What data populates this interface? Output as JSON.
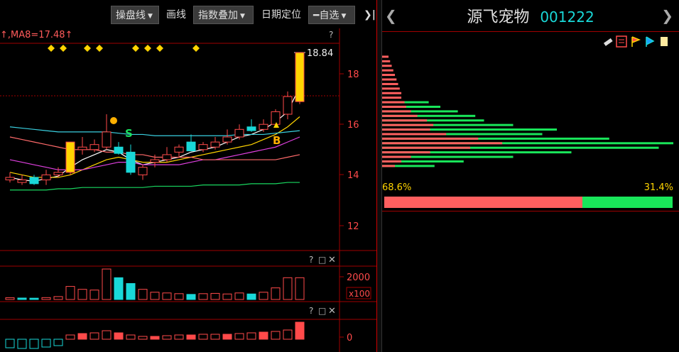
{
  "toolbar": {
    "cost_dist_label": "操盘线",
    "draw_label": "画线",
    "index_overlay_label": "指数叠加",
    "date_locate_label": "日期定位",
    "watchlist_label": "自选",
    "collapse_glyph": "❯|"
  },
  "main_panel": {
    "ma_legend": "↑,MA8=17.48↑",
    "help_mark": "?",
    "price_high_label": "18.84",
    "y_ticks": [
      "18",
      "16",
      "14",
      "12"
    ],
    "signal_sell": "S",
    "signal_buy": "B"
  },
  "volume_panel": {
    "y_tick": "2000",
    "unit_label": "x100",
    "controls": [
      "?",
      "□",
      "✕"
    ]
  },
  "indicator_panel": {
    "y_tick": "0",
    "controls": [
      "?",
      "□",
      "✕"
    ]
  },
  "stock": {
    "name": "源飞宠物",
    "code": "001222"
  },
  "chip_panel": {
    "profit_ratio_label": "68.6%",
    "loss_ratio_label": "31.4%",
    "profit_ratio": 0.686,
    "colors": {
      "profit": "#ff5f5f",
      "loss": "#19e65a"
    }
  },
  "colors": {
    "up": "#ff4a4a",
    "down": "#19d8d8",
    "accent_yellow": "#ffd400",
    "grid_red": "#a00000"
  },
  "chart_data": {
    "type": "candlestick",
    "y_range": [
      11.0,
      19.3
    ],
    "candles": [
      {
        "o": 13.9,
        "h": 14.1,
        "l": 13.7,
        "c": 13.8,
        "color": "up"
      },
      {
        "o": 13.8,
        "h": 14.0,
        "l": 13.6,
        "c": 13.7,
        "color": "up"
      },
      {
        "o": 13.9,
        "h": 14.0,
        "l": 13.6,
        "c": 13.65,
        "color": "down"
      },
      {
        "o": 13.8,
        "h": 14.2,
        "l": 13.6,
        "c": 14.0,
        "color": "up"
      },
      {
        "o": 14.0,
        "h": 14.3,
        "l": 13.9,
        "c": 14.1,
        "color": "up"
      },
      {
        "o": 14.1,
        "h": 15.3,
        "l": 14.0,
        "c": 15.3,
        "color": "limit"
      },
      {
        "o": 15.0,
        "h": 15.5,
        "l": 14.8,
        "c": 15.1,
        "color": "up"
      },
      {
        "o": 15.0,
        "h": 15.4,
        "l": 14.9,
        "c": 15.2,
        "color": "up"
      },
      {
        "o": 15.1,
        "h": 16.4,
        "l": 15.0,
        "c": 15.7,
        "color": "up"
      },
      {
        "o": 15.1,
        "h": 15.3,
        "l": 14.8,
        "c": 14.85,
        "color": "down"
      },
      {
        "o": 14.9,
        "h": 15.2,
        "l": 14.0,
        "c": 14.1,
        "color": "down"
      },
      {
        "o": 14.0,
        "h": 14.4,
        "l": 13.8,
        "c": 14.3,
        "color": "up"
      },
      {
        "o": 14.5,
        "h": 14.8,
        "l": 14.3,
        "c": 14.6,
        "color": "up"
      },
      {
        "o": 14.6,
        "h": 15.1,
        "l": 14.5,
        "c": 14.8,
        "color": "up"
      },
      {
        "o": 14.9,
        "h": 15.2,
        "l": 14.7,
        "c": 15.1,
        "color": "up"
      },
      {
        "o": 15.3,
        "h": 15.6,
        "l": 15.0,
        "c": 14.95,
        "color": "down"
      },
      {
        "o": 15.0,
        "h": 15.3,
        "l": 14.9,
        "c": 15.2,
        "color": "up"
      },
      {
        "o": 15.1,
        "h": 15.5,
        "l": 15.0,
        "c": 15.3,
        "color": "up"
      },
      {
        "o": 15.3,
        "h": 15.8,
        "l": 15.2,
        "c": 15.5,
        "color": "up"
      },
      {
        "o": 15.5,
        "h": 16.0,
        "l": 15.4,
        "c": 15.8,
        "color": "up"
      },
      {
        "o": 15.9,
        "h": 16.2,
        "l": 15.7,
        "c": 15.75,
        "color": "down"
      },
      {
        "o": 15.8,
        "h": 16.2,
        "l": 15.7,
        "c": 16.0,
        "color": "up"
      },
      {
        "o": 16.0,
        "h": 16.6,
        "l": 15.9,
        "c": 16.5,
        "color": "up"
      },
      {
        "o": 16.4,
        "h": 17.3,
        "l": 16.2,
        "c": 17.1,
        "color": "up"
      },
      {
        "o": 16.9,
        "h": 18.84,
        "l": 16.8,
        "c": 18.84,
        "color": "limit"
      }
    ],
    "volume": [
      {
        "v": 120,
        "color": "up"
      },
      {
        "v": 100,
        "color": "down"
      },
      {
        "v": 90,
        "color": "down"
      },
      {
        "v": 130,
        "color": "up"
      },
      {
        "v": 200,
        "color": "up"
      },
      {
        "v": 900,
        "color": "up"
      },
      {
        "v": 700,
        "color": "up"
      },
      {
        "v": 650,
        "color": "up"
      },
      {
        "v": 2100,
        "color": "up"
      },
      {
        "v": 1500,
        "color": "down"
      },
      {
        "v": 1100,
        "color": "down"
      },
      {
        "v": 700,
        "color": "up"
      },
      {
        "v": 500,
        "color": "up"
      },
      {
        "v": 450,
        "color": "up"
      },
      {
        "v": 400,
        "color": "up"
      },
      {
        "v": 350,
        "color": "down"
      },
      {
        "v": 400,
        "color": "up"
      },
      {
        "v": 420,
        "color": "up"
      },
      {
        "v": 380,
        "color": "up"
      },
      {
        "v": 450,
        "color": "up"
      },
      {
        "v": 380,
        "color": "down"
      },
      {
        "v": 500,
        "color": "up"
      },
      {
        "v": 800,
        "color": "up"
      },
      {
        "v": 1500,
        "color": "up"
      },
      {
        "v": 1500,
        "color": "up"
      }
    ],
    "indicator": [
      {
        "v": -1.2,
        "color": "down"
      },
      {
        "v": -1.3,
        "color": "down"
      },
      {
        "v": -1.3,
        "color": "down"
      },
      {
        "v": -1.1,
        "color": "down"
      },
      {
        "v": -0.9,
        "color": "down"
      },
      {
        "v": 0.6,
        "color": "up"
      },
      {
        "v": 0.8,
        "color": "up"
      },
      {
        "v": 0.9,
        "color": "up"
      },
      {
        "v": 1.2,
        "color": "up"
      },
      {
        "v": 0.9,
        "color": "up"
      },
      {
        "v": 0.6,
        "color": "up"
      },
      {
        "v": 0.4,
        "color": "up"
      },
      {
        "v": 0.4,
        "color": "up"
      },
      {
        "v": 0.5,
        "color": "up"
      },
      {
        "v": 0.6,
        "color": "up"
      },
      {
        "v": 0.6,
        "color": "up"
      },
      {
        "v": 0.7,
        "color": "up"
      },
      {
        "v": 0.7,
        "color": "up"
      },
      {
        "v": 0.7,
        "color": "up"
      },
      {
        "v": 0.8,
        "color": "up"
      },
      {
        "v": 0.9,
        "color": "up"
      },
      {
        "v": 1.0,
        "color": "up"
      },
      {
        "v": 1.1,
        "color": "up"
      },
      {
        "v": 1.3,
        "color": "up"
      },
      {
        "v": 2.4,
        "color": "up"
      }
    ],
    "ma_lines": [
      {
        "color": "#ffffff",
        "values": [
          13.9,
          13.8,
          13.75,
          13.85,
          13.95,
          14.3,
          14.6,
          14.8,
          15.0,
          14.9,
          14.6,
          14.4,
          14.5,
          14.6,
          14.7,
          14.9,
          15.0,
          15.1,
          15.3,
          15.5,
          15.6,
          15.8,
          16.1,
          16.5,
          17.48
        ]
      },
      {
        "color": "#ffd400",
        "values": [
          14.1,
          14.0,
          13.9,
          13.9,
          13.9,
          14.0,
          14.2,
          14.4,
          14.6,
          14.7,
          14.6,
          14.5,
          14.5,
          14.5,
          14.6,
          14.7,
          14.8,
          14.9,
          15.0,
          15.1,
          15.2,
          15.4,
          15.6,
          15.9,
          16.3
        ]
      },
      {
        "color": "#e040e0",
        "values": [
          14.6,
          14.5,
          14.4,
          14.3,
          14.2,
          14.2,
          14.2,
          14.3,
          14.4,
          14.5,
          14.5,
          14.4,
          14.4,
          14.4,
          14.4,
          14.5,
          14.6,
          14.6,
          14.7,
          14.8,
          14.9,
          15.0,
          15.1,
          15.3,
          15.5
        ]
      },
      {
        "color": "#3ad0e0",
        "values": [
          15.9,
          15.85,
          15.8,
          15.75,
          15.7,
          15.7,
          15.7,
          15.7,
          15.7,
          15.65,
          15.6,
          15.6,
          15.55,
          15.55,
          15.55,
          15.55,
          15.55,
          15.55,
          15.55,
          15.6,
          15.6,
          15.6,
          15.65,
          15.7,
          15.75
        ]
      },
      {
        "color": "#ff6a6a",
        "values": [
          15.5,
          15.4,
          15.3,
          15.2,
          15.1,
          15.0,
          15.0,
          15.0,
          14.9,
          14.9,
          14.8,
          14.8,
          14.7,
          14.7,
          14.7,
          14.7,
          14.6,
          14.6,
          14.6,
          14.6,
          14.6,
          14.6,
          14.6,
          14.7,
          14.8
        ]
      },
      {
        "color": "#19d860",
        "values": [
          13.4,
          13.4,
          13.4,
          13.4,
          13.45,
          13.45,
          13.5,
          13.5,
          13.5,
          13.5,
          13.5,
          13.5,
          13.55,
          13.55,
          13.55,
          13.55,
          13.6,
          13.6,
          13.6,
          13.6,
          13.65,
          13.65,
          13.65,
          13.7,
          13.7
        ]
      }
    ],
    "chip_distribution": {
      "price_range": [
        13.7,
        19.0
      ],
      "profit_levels": [
        {
          "p": 14.0,
          "w": 0.08
        },
        {
          "p": 14.2,
          "w": 0.12
        },
        {
          "p": 14.4,
          "w": 0.18
        },
        {
          "p": 14.6,
          "w": 0.3
        },
        {
          "p": 14.8,
          "w": 0.55
        },
        {
          "p": 15.0,
          "w": 0.75
        },
        {
          "p": 15.2,
          "w": 0.6
        },
        {
          "p": 15.4,
          "w": 0.4
        },
        {
          "p": 15.6,
          "w": 0.3
        },
        {
          "p": 15.8,
          "w": 0.32
        },
        {
          "p": 16.0,
          "w": 0.28
        },
        {
          "p": 16.2,
          "w": 0.22
        },
        {
          "p": 16.4,
          "w": 0.18
        },
        {
          "p": 16.6,
          "w": 0.15
        },
        {
          "p": 16.8,
          "w": 0.14
        },
        {
          "p": 17.0,
          "w": 0.12
        },
        {
          "p": 17.2,
          "w": 0.12
        },
        {
          "p": 17.4,
          "w": 0.11
        },
        {
          "p": 17.6,
          "w": 0.1
        },
        {
          "p": 17.8,
          "w": 0.09
        },
        {
          "p": 18.0,
          "w": 0.08
        },
        {
          "p": 18.2,
          "w": 0.07
        },
        {
          "p": 18.4,
          "w": 0.06
        },
        {
          "p": 18.6,
          "w": 0.05
        },
        {
          "p": 18.8,
          "w": 0.04
        }
      ],
      "loss_levels": [
        {
          "p": 14.0,
          "w": 0.18
        },
        {
          "p": 14.2,
          "w": 0.28
        },
        {
          "p": 14.4,
          "w": 0.45
        },
        {
          "p": 14.6,
          "w": 0.65
        },
        {
          "p": 14.8,
          "w": 0.95
        },
        {
          "p": 15.0,
          "w": 1.0
        },
        {
          "p": 15.2,
          "w": 0.78
        },
        {
          "p": 15.4,
          "w": 0.55
        },
        {
          "p": 15.6,
          "w": 0.6
        },
        {
          "p": 15.8,
          "w": 0.45
        },
        {
          "p": 16.0,
          "w": 0.35
        },
        {
          "p": 16.2,
          "w": 0.32
        },
        {
          "p": 16.4,
          "w": 0.26
        },
        {
          "p": 16.6,
          "w": 0.2
        },
        {
          "p": 16.8,
          "w": 0.16
        }
      ]
    }
  }
}
